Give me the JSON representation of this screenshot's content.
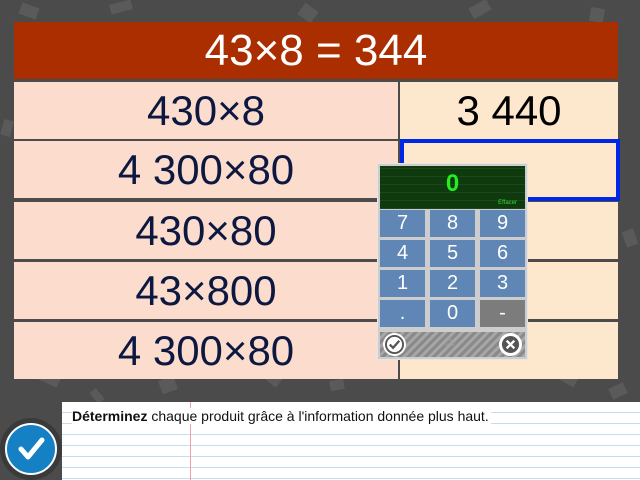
{
  "header": {
    "equation": "43×8 = 344"
  },
  "rows": [
    {
      "expression": "430×8",
      "answer": "3 440"
    },
    {
      "expression": "4 300×80",
      "answer": ""
    },
    {
      "expression": "430×80",
      "answer": ""
    },
    {
      "expression": "43×800",
      "answer": ""
    },
    {
      "expression": "4 300×80",
      "answer": ""
    }
  ],
  "keypad": {
    "display_value": "0",
    "clear_label": "Effacer",
    "keys": [
      "7",
      "8",
      "9",
      "4",
      "5",
      "6",
      "1",
      "2",
      "3",
      ".",
      "0",
      "-"
    ],
    "ok_icon": "check-icon",
    "close_icon": "close-icon"
  },
  "instruction": {
    "bold": "Déterminez",
    "text": " chaque produit grâce à l'information donnée plus haut."
  },
  "colors": {
    "title_bg": "#aa2e00",
    "expr_bg": "#fcdccd",
    "answer_bg": "#fde7cd",
    "active_border": "#0027e6",
    "keypad_key": "#5f86b4",
    "display_digit": "#22ee22"
  }
}
